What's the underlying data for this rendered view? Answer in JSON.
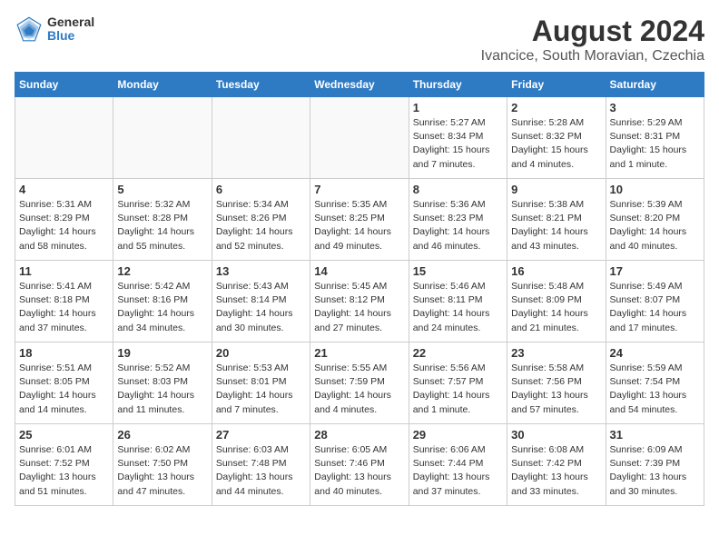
{
  "header": {
    "logo": {
      "line1": "General",
      "line2": "Blue"
    },
    "title": "August 2024",
    "subtitle": "Ivancice, South Moravian, Czechia"
  },
  "days_of_week": [
    "Sunday",
    "Monday",
    "Tuesday",
    "Wednesday",
    "Thursday",
    "Friday",
    "Saturday"
  ],
  "weeks": [
    [
      {
        "day": "",
        "info": ""
      },
      {
        "day": "",
        "info": ""
      },
      {
        "day": "",
        "info": ""
      },
      {
        "day": "",
        "info": ""
      },
      {
        "day": "1",
        "info": "Sunrise: 5:27 AM\nSunset: 8:34 PM\nDaylight: 15 hours\nand 7 minutes."
      },
      {
        "day": "2",
        "info": "Sunrise: 5:28 AM\nSunset: 8:32 PM\nDaylight: 15 hours\nand 4 minutes."
      },
      {
        "day": "3",
        "info": "Sunrise: 5:29 AM\nSunset: 8:31 PM\nDaylight: 15 hours\nand 1 minute."
      }
    ],
    [
      {
        "day": "4",
        "info": "Sunrise: 5:31 AM\nSunset: 8:29 PM\nDaylight: 14 hours\nand 58 minutes."
      },
      {
        "day": "5",
        "info": "Sunrise: 5:32 AM\nSunset: 8:28 PM\nDaylight: 14 hours\nand 55 minutes."
      },
      {
        "day": "6",
        "info": "Sunrise: 5:34 AM\nSunset: 8:26 PM\nDaylight: 14 hours\nand 52 minutes."
      },
      {
        "day": "7",
        "info": "Sunrise: 5:35 AM\nSunset: 8:25 PM\nDaylight: 14 hours\nand 49 minutes."
      },
      {
        "day": "8",
        "info": "Sunrise: 5:36 AM\nSunset: 8:23 PM\nDaylight: 14 hours\nand 46 minutes."
      },
      {
        "day": "9",
        "info": "Sunrise: 5:38 AM\nSunset: 8:21 PM\nDaylight: 14 hours\nand 43 minutes."
      },
      {
        "day": "10",
        "info": "Sunrise: 5:39 AM\nSunset: 8:20 PM\nDaylight: 14 hours\nand 40 minutes."
      }
    ],
    [
      {
        "day": "11",
        "info": "Sunrise: 5:41 AM\nSunset: 8:18 PM\nDaylight: 14 hours\nand 37 minutes."
      },
      {
        "day": "12",
        "info": "Sunrise: 5:42 AM\nSunset: 8:16 PM\nDaylight: 14 hours\nand 34 minutes."
      },
      {
        "day": "13",
        "info": "Sunrise: 5:43 AM\nSunset: 8:14 PM\nDaylight: 14 hours\nand 30 minutes."
      },
      {
        "day": "14",
        "info": "Sunrise: 5:45 AM\nSunset: 8:12 PM\nDaylight: 14 hours\nand 27 minutes."
      },
      {
        "day": "15",
        "info": "Sunrise: 5:46 AM\nSunset: 8:11 PM\nDaylight: 14 hours\nand 24 minutes."
      },
      {
        "day": "16",
        "info": "Sunrise: 5:48 AM\nSunset: 8:09 PM\nDaylight: 14 hours\nand 21 minutes."
      },
      {
        "day": "17",
        "info": "Sunrise: 5:49 AM\nSunset: 8:07 PM\nDaylight: 14 hours\nand 17 minutes."
      }
    ],
    [
      {
        "day": "18",
        "info": "Sunrise: 5:51 AM\nSunset: 8:05 PM\nDaylight: 14 hours\nand 14 minutes."
      },
      {
        "day": "19",
        "info": "Sunrise: 5:52 AM\nSunset: 8:03 PM\nDaylight: 14 hours\nand 11 minutes."
      },
      {
        "day": "20",
        "info": "Sunrise: 5:53 AM\nSunset: 8:01 PM\nDaylight: 14 hours\nand 7 minutes."
      },
      {
        "day": "21",
        "info": "Sunrise: 5:55 AM\nSunset: 7:59 PM\nDaylight: 14 hours\nand 4 minutes."
      },
      {
        "day": "22",
        "info": "Sunrise: 5:56 AM\nSunset: 7:57 PM\nDaylight: 14 hours\nand 1 minute."
      },
      {
        "day": "23",
        "info": "Sunrise: 5:58 AM\nSunset: 7:56 PM\nDaylight: 13 hours\nand 57 minutes."
      },
      {
        "day": "24",
        "info": "Sunrise: 5:59 AM\nSunset: 7:54 PM\nDaylight: 13 hours\nand 54 minutes."
      }
    ],
    [
      {
        "day": "25",
        "info": "Sunrise: 6:01 AM\nSunset: 7:52 PM\nDaylight: 13 hours\nand 51 minutes."
      },
      {
        "day": "26",
        "info": "Sunrise: 6:02 AM\nSunset: 7:50 PM\nDaylight: 13 hours\nand 47 minutes."
      },
      {
        "day": "27",
        "info": "Sunrise: 6:03 AM\nSunset: 7:48 PM\nDaylight: 13 hours\nand 44 minutes."
      },
      {
        "day": "28",
        "info": "Sunrise: 6:05 AM\nSunset: 7:46 PM\nDaylight: 13 hours\nand 40 minutes."
      },
      {
        "day": "29",
        "info": "Sunrise: 6:06 AM\nSunset: 7:44 PM\nDaylight: 13 hours\nand 37 minutes."
      },
      {
        "day": "30",
        "info": "Sunrise: 6:08 AM\nSunset: 7:42 PM\nDaylight: 13 hours\nand 33 minutes."
      },
      {
        "day": "31",
        "info": "Sunrise: 6:09 AM\nSunset: 7:39 PM\nDaylight: 13 hours\nand 30 minutes."
      }
    ]
  ]
}
